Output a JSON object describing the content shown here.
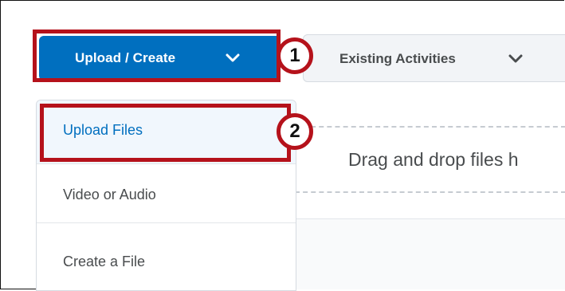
{
  "toolbar": {
    "upload_create_label": "Upload / Create",
    "existing_activities_label": "Existing Activities"
  },
  "callouts": [
    "1",
    "2"
  ],
  "dropzone": {
    "text": "Drag and drop files h"
  },
  "menu": {
    "items": [
      {
        "label": "Upload Files",
        "active": true
      },
      {
        "label": "Video or Audio",
        "active": false
      },
      {
        "label": "Create a File",
        "active": false
      }
    ]
  },
  "colors": {
    "primary_button": "#006fbf",
    "highlight": "#b5121b",
    "active_menu_bg": "#f1f7fd",
    "text": "#494c4e"
  },
  "icons": {
    "upload_chevron": "chevron-down-icon",
    "existing_chevron": "chevron-down-icon"
  }
}
